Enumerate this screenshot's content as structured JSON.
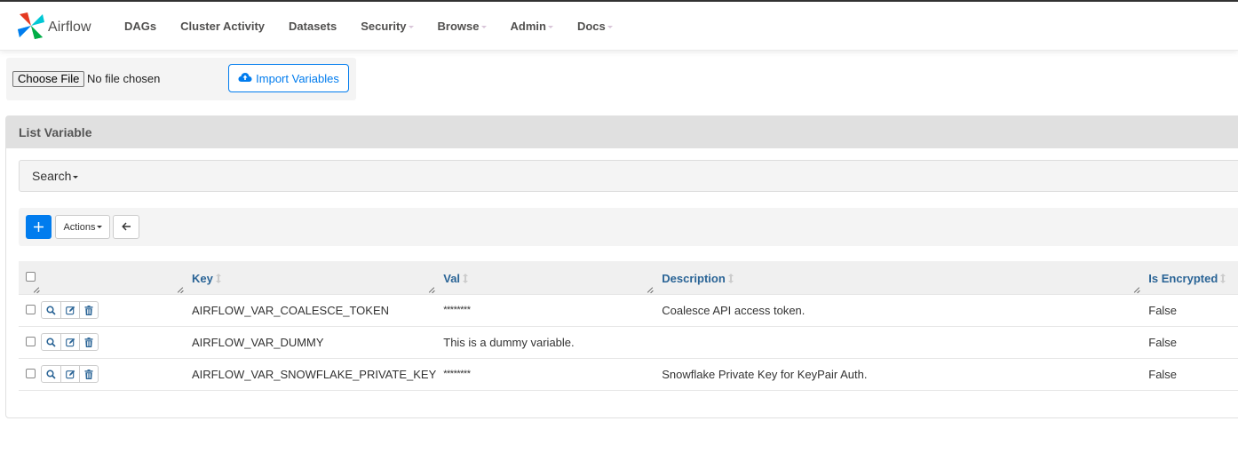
{
  "navbar": {
    "brand": "Airflow",
    "items": [
      {
        "label": "DAGs",
        "dropdown": false
      },
      {
        "label": "Cluster Activity",
        "dropdown": false
      },
      {
        "label": "Datasets",
        "dropdown": false
      },
      {
        "label": "Security",
        "dropdown": true
      },
      {
        "label": "Browse",
        "dropdown": true
      },
      {
        "label": "Admin",
        "dropdown": true
      },
      {
        "label": "Docs",
        "dropdown": true
      }
    ]
  },
  "import": {
    "choose_file_label": "Choose File",
    "file_status": "No file chosen",
    "import_button": "Import Variables",
    "icon": "cloud-upload-icon"
  },
  "panel": {
    "title": "List Variable",
    "search_label": "Search",
    "toolbar": {
      "add_icon": "plus-icon",
      "actions_label": "Actions",
      "back_icon": "arrow-left-icon"
    }
  },
  "colors": {
    "accent": "#017cee",
    "header_link": "#2a6496",
    "panel_heading_bg": "#e0e0e0"
  },
  "table": {
    "columns": [
      "Key",
      "Val",
      "Description",
      "Is Encrypted"
    ],
    "row_actions": [
      "search-icon",
      "edit-icon",
      "trash-icon"
    ],
    "rows": [
      {
        "key": "AIRFLOW_VAR_COALESCE_TOKEN",
        "val": "********",
        "description": "Coalesce API access token.",
        "is_encrypted": "False"
      },
      {
        "key": "AIRFLOW_VAR_DUMMY",
        "val": "This is a dummy variable.",
        "description": "",
        "is_encrypted": "False"
      },
      {
        "key": "AIRFLOW_VAR_SNOWFLAKE_PRIVATE_KEY",
        "val": "********",
        "description": "Snowflake Private Key for KeyPair Auth.",
        "is_encrypted": "False"
      }
    ]
  }
}
